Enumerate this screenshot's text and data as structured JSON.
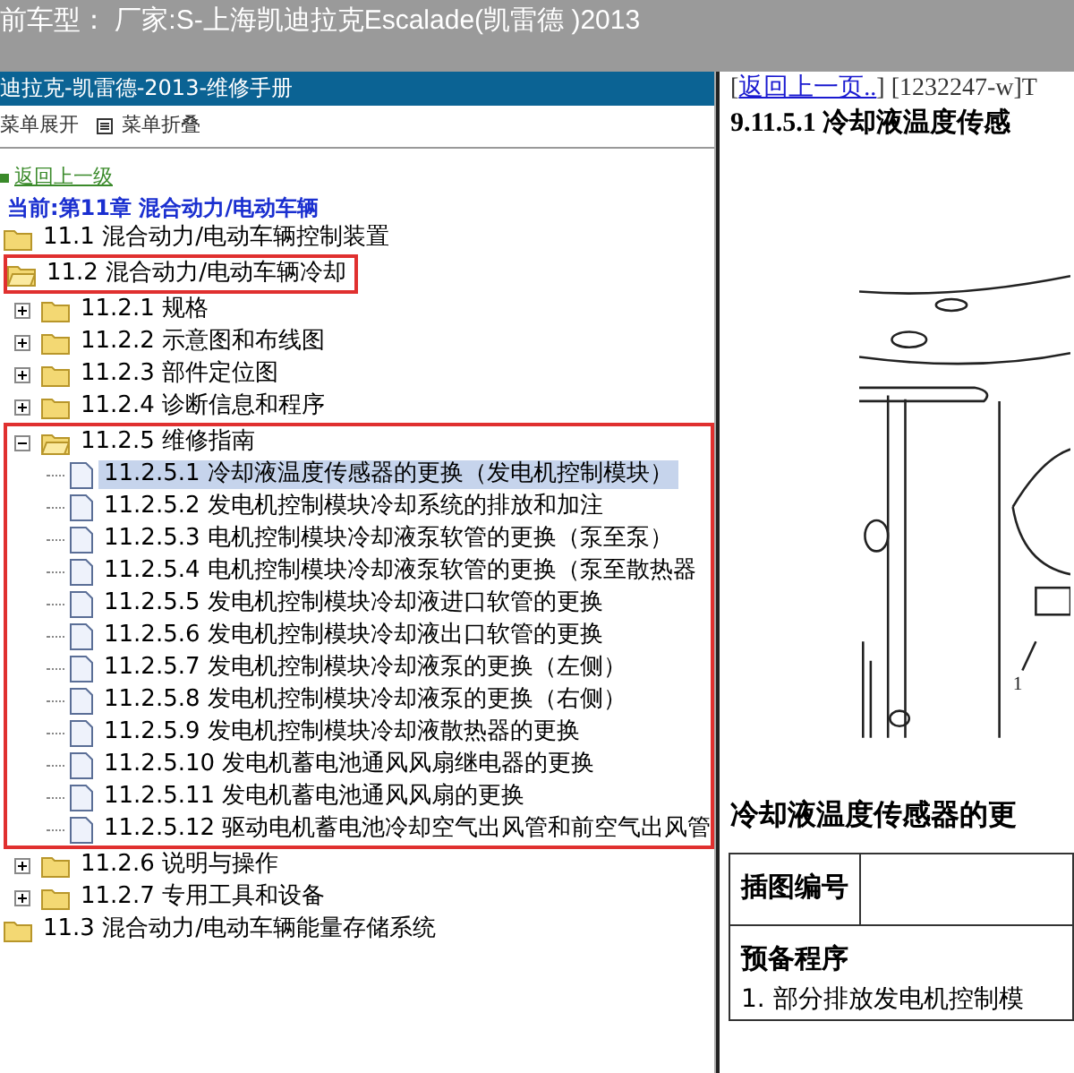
{
  "window": {
    "title": "前车型： 厂家:S-上海凯迪拉克Escalade(凯雷德 )2013"
  },
  "sidebar": {
    "title": "迪拉克-凯雷德-2013-维修手册",
    "toolbar": [
      "菜单展开",
      "菜单折叠"
    ],
    "back_link": "返回上一级",
    "current": "当前:第11章 混合动力/电动车辆",
    "tree": [
      {
        "label": "11.1 混合动力/电动车辆控制装置",
        "kind": "folder",
        "expanded": false,
        "selected": false
      },
      {
        "label": "11.2 混合动力/电动车辆冷却",
        "kind": "folder",
        "expanded": true,
        "selected": false,
        "highlighted": true,
        "children": [
          {
            "label": "11.2.1 规格",
            "kind": "folder",
            "expanded": false,
            "selected": false
          },
          {
            "label": "11.2.2 示意图和布线图",
            "kind": "folder",
            "expanded": false,
            "selected": false
          },
          {
            "label": "11.2.3 部件定位图",
            "kind": "folder",
            "expanded": false,
            "selected": false
          },
          {
            "label": "11.2.4 诊断信息和程序",
            "kind": "folder",
            "expanded": false,
            "selected": false
          },
          {
            "label": "11.2.5 维修指南",
            "kind": "folder",
            "expanded": true,
            "selected": false,
            "highlighted": true,
            "children": [
              {
                "label": "11.2.5.1 冷却液温度传感器的更换（发电机控制模块）",
                "kind": "page",
                "selected": true
              },
              {
                "label": "11.2.5.2 发电机控制模块冷却系统的排放和加注",
                "kind": "page",
                "selected": false
              },
              {
                "label": "11.2.5.3 电机控制模块冷却液泵软管的更换（泵至泵）",
                "kind": "page",
                "selected": false
              },
              {
                "label": "11.2.5.4 电机控制模块冷却液泵软管的更换（泵至散热器",
                "kind": "page",
                "selected": false
              },
              {
                "label": "11.2.5.5 发电机控制模块冷却液进口软管的更换",
                "kind": "page",
                "selected": false
              },
              {
                "label": "11.2.5.6 发电机控制模块冷却液出口软管的更换",
                "kind": "page",
                "selected": false
              },
              {
                "label": "11.2.5.7 发电机控制模块冷却液泵的更换（左侧）",
                "kind": "page",
                "selected": false
              },
              {
                "label": "11.2.5.8 发电机控制模块冷却液泵的更换（右侧）",
                "kind": "page",
                "selected": false
              },
              {
                "label": "11.2.5.9 发电机控制模块冷却液散热器的更换",
                "kind": "page",
                "selected": false
              },
              {
                "label": "11.2.5.10 发电机蓄电池通风风扇继电器的更换",
                "kind": "page",
                "selected": false
              },
              {
                "label": "11.2.5.11 发电机蓄电池通风风扇的更换",
                "kind": "page",
                "selected": false
              },
              {
                "label": "11.2.5.12 驱动电机蓄电池冷却空气出风管和前空气出风管",
                "kind": "page",
                "selected": false
              }
            ]
          },
          {
            "label": "11.2.6 说明与操作",
            "kind": "folder",
            "expanded": false,
            "selected": false
          },
          {
            "label": "11.2.7 专用工具和设备",
            "kind": "folder",
            "expanded": false,
            "selected": false
          }
        ]
      },
      {
        "label": "11.3 混合动力/电动车辆能量存储系统",
        "kind": "folder",
        "expanded": false,
        "selected": false
      }
    ]
  },
  "content": {
    "nav": {
      "open": "[",
      "link": "返回上一页..",
      "rest": "] [1232247-w]T"
    },
    "heading": "9.11.5.1 冷却液温度传感",
    "figure": {
      "callout": "1"
    },
    "subheading": "冷却液温度传感器的更",
    "table": {
      "header": "插图编号",
      "section": "预备程序",
      "step": "1. 部分排放发电机控制模"
    }
  }
}
